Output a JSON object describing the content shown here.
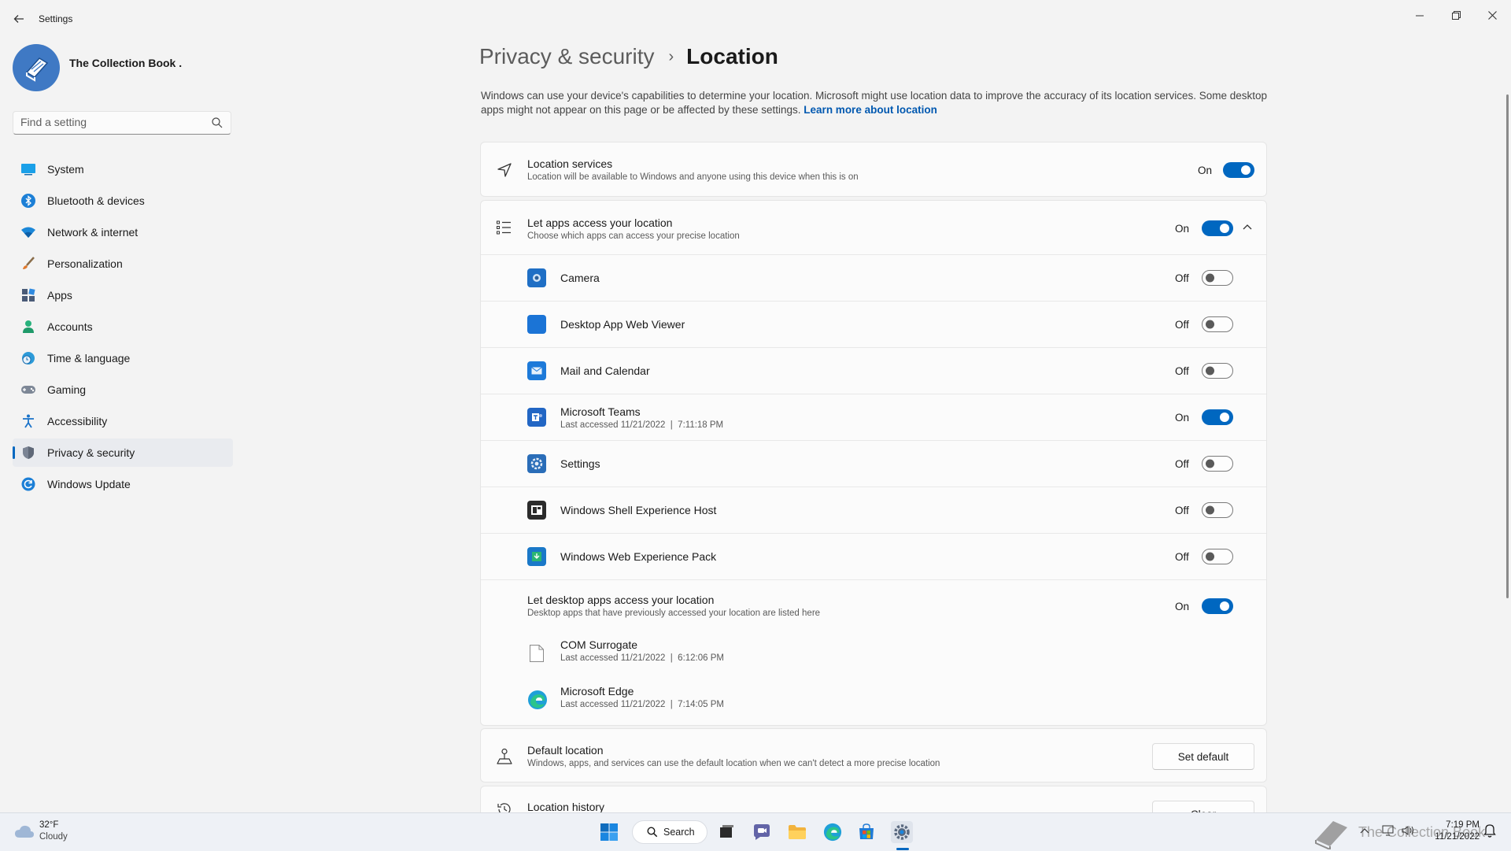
{
  "window": {
    "title": "Settings",
    "controls": {
      "minimize": "—",
      "maximize": "❐",
      "close": "✕"
    }
  },
  "profile": {
    "name": "The Collection Book ."
  },
  "search": {
    "placeholder": "Find a setting"
  },
  "sidebar": {
    "items": [
      {
        "label": "System",
        "icon": "system-icon"
      },
      {
        "label": "Bluetooth & devices",
        "icon": "bluetooth-icon"
      },
      {
        "label": "Network & internet",
        "icon": "wifi-icon"
      },
      {
        "label": "Personalization",
        "icon": "brush-icon"
      },
      {
        "label": "Apps",
        "icon": "apps-icon"
      },
      {
        "label": "Accounts",
        "icon": "person-icon"
      },
      {
        "label": "Time & language",
        "icon": "clock-globe-icon"
      },
      {
        "label": "Gaming",
        "icon": "gamepad-icon"
      },
      {
        "label": "Accessibility",
        "icon": "accessibility-icon"
      },
      {
        "label": "Privacy & security",
        "icon": "shield-icon",
        "active": true
      },
      {
        "label": "Windows Update",
        "icon": "update-icon"
      }
    ]
  },
  "breadcrumb": {
    "parent": "Privacy & security",
    "separator": "›",
    "current": "Location"
  },
  "intro": {
    "text": "Windows can use your device's capabilities to determine your location. Microsoft might use location data to improve the accuracy of its location services. Some desktop apps might not appear on this page or be affected by these settings.",
    "link": "Learn more about location"
  },
  "location_services": {
    "title": "Location services",
    "subtitle": "Location will be available to Windows and anyone using this device when this is on",
    "state": "On",
    "on": true
  },
  "app_access": {
    "title": "Let apps access your location",
    "subtitle": "Choose which apps can access your precise location",
    "state": "On",
    "on": true,
    "apps": [
      {
        "name": "Camera",
        "sub": "",
        "state": "Off",
        "on": false,
        "icon": "camera-app-icon"
      },
      {
        "name": "Desktop App Web Viewer",
        "sub": "",
        "state": "Off",
        "on": false,
        "icon": "web-viewer-icon"
      },
      {
        "name": "Mail and Calendar",
        "sub": "",
        "state": "Off",
        "on": false,
        "icon": "mail-icon"
      },
      {
        "name": "Microsoft Teams",
        "sub": "Last accessed 11/21/2022  |  7:11:18 PM",
        "state": "On",
        "on": true,
        "icon": "teams-icon"
      },
      {
        "name": "Settings",
        "sub": "",
        "state": "Off",
        "on": false,
        "icon": "settings-app-icon"
      },
      {
        "name": "Windows Shell Experience Host",
        "sub": "",
        "state": "Off",
        "on": false,
        "icon": "shell-host-icon"
      },
      {
        "name": "Windows Web Experience Pack",
        "sub": "",
        "state": "Off",
        "on": false,
        "icon": "web-experience-icon"
      }
    ]
  },
  "desktop_access": {
    "title": "Let desktop apps access your location",
    "subtitle": "Desktop apps that have previously accessed your location are listed here",
    "state": "On",
    "on": true,
    "apps": [
      {
        "name": "COM Surrogate",
        "sub": "Last accessed 11/21/2022  |  6:12:06 PM",
        "icon": "file-icon"
      },
      {
        "name": "Microsoft Edge",
        "sub": "Last accessed 11/21/2022  |  7:14:05 PM",
        "icon": "edge-icon"
      }
    ]
  },
  "default_location": {
    "title": "Default location",
    "subtitle": "Windows, apps, and services can use the default location when we can't detect a more precise location",
    "button": "Set default"
  },
  "location_history": {
    "title": "Location history",
    "button": "Clear"
  },
  "taskbar": {
    "weather": {
      "temp": "32°F",
      "condition": "Cloudy"
    },
    "search_label": "Search",
    "clock": {
      "time": "7:19 PM",
      "date": "11/21/2022"
    },
    "watermark": "The Collection Book"
  },
  "colors": {
    "accent": "#0067c0",
    "background": "#f3f3f3",
    "card": "#fbfbfb"
  }
}
